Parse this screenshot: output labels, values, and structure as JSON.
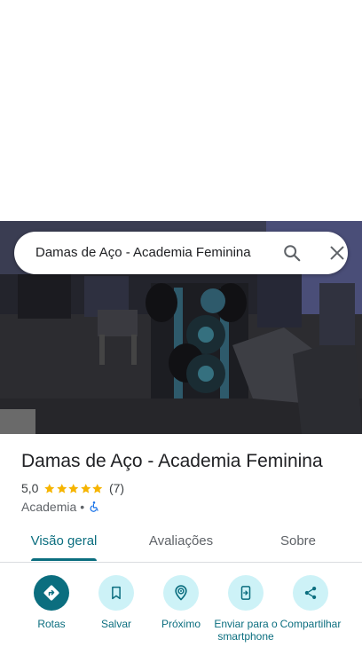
{
  "search": {
    "query": "Damas de Aço - Academia Feminina"
  },
  "place": {
    "name": "Damas de Aço - Academia Feminina",
    "rating": "5,0",
    "review_count": "(7)",
    "category": "Academia",
    "separator": "•",
    "stars": 5
  },
  "tabs": [
    {
      "label": "Visão geral",
      "active": true
    },
    {
      "label": "Avaliações",
      "active": false
    },
    {
      "label": "Sobre",
      "active": false
    }
  ],
  "actions": [
    {
      "label": "Rotas",
      "icon": "directions-icon"
    },
    {
      "label": "Salvar",
      "icon": "bookmark-icon"
    },
    {
      "label": "Próximo",
      "icon": "nearby-icon"
    },
    {
      "label": "Enviar para o smartphone",
      "icon": "send-to-phone-icon"
    },
    {
      "label": "Compartilhar",
      "icon": "share-icon"
    }
  ],
  "colors": {
    "accent": "#0b6e7f",
    "action_bg": "#cdf2f7",
    "star": "#f6b400"
  }
}
